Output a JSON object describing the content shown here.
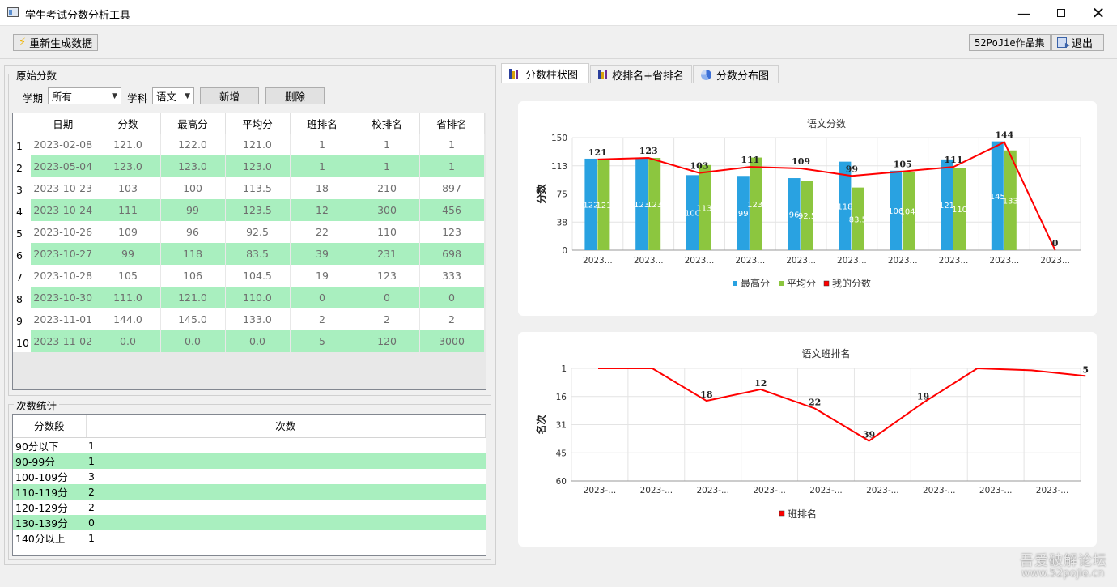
{
  "window": {
    "title": "学生考试分数分析工具"
  },
  "toolbar": {
    "regen": "重新生成数据",
    "works": "52PoJie作品集",
    "exit": "退出"
  },
  "left": {
    "raw_group": "原始分数",
    "term_label": "学期",
    "term_value": "所有",
    "subject_label": "学科",
    "subject_value": "语文",
    "add": "新增",
    "del": "删除",
    "columns": [
      "日期",
      "分数",
      "最高分",
      "平均分",
      "班排名",
      "校排名",
      "省排名"
    ],
    "rows": [
      [
        "2023-02-08",
        "121.0",
        "122.0",
        "121.0",
        "1",
        "1",
        "1"
      ],
      [
        "2023-05-04",
        "123.0",
        "123.0",
        "123.0",
        "1",
        "1",
        "1"
      ],
      [
        "2023-10-23",
        "103",
        "100",
        "113.5",
        "18",
        "210",
        "897"
      ],
      [
        "2023-10-24",
        "111",
        "99",
        "123.5",
        "12",
        "300",
        "456"
      ],
      [
        "2023-10-26",
        "109",
        "96",
        "92.5",
        "22",
        "110",
        "123"
      ],
      [
        "2023-10-27",
        "99",
        "118",
        "83.5",
        "39",
        "231",
        "698"
      ],
      [
        "2023-10-28",
        "105",
        "106",
        "104.5",
        "19",
        "123",
        "333"
      ],
      [
        "2023-10-30",
        "111.0",
        "121.0",
        "110.0",
        "0",
        "0",
        "0"
      ],
      [
        "2023-11-01",
        "144.0",
        "145.0",
        "133.0",
        "2",
        "2",
        "2"
      ],
      [
        "2023-11-02",
        "0.0",
        "0.0",
        "0.0",
        "5",
        "120",
        "3000"
      ]
    ],
    "row_numbers": [
      "1",
      "2",
      "3",
      "4",
      "5",
      "6",
      "7",
      "8",
      "9",
      "10"
    ],
    "count_group": "次数统计",
    "count_columns": [
      "分数段",
      "次数"
    ],
    "count_rows": [
      [
        "90分以下",
        "1"
      ],
      [
        "90-99分",
        "1"
      ],
      [
        "100-109分",
        "3"
      ],
      [
        "110-119分",
        "2"
      ],
      [
        "120-129分",
        "2"
      ],
      [
        "130-139分",
        "0"
      ],
      [
        "140分以上",
        "1"
      ]
    ]
  },
  "tabs": [
    "分数柱状图",
    "校排名+省排名",
    "分数分布图"
  ],
  "watermark": {
    "line1": "吾爱破解论坛",
    "line2": "www.52pojie.cn"
  },
  "colors": {
    "max": "#29a2e1",
    "avg": "#8cc63f",
    "mine": "#ff0000",
    "alt_row": "#a9efbf"
  },
  "chart_data": [
    {
      "type": "bar",
      "title": "语文分数",
      "ylabel": "分数",
      "ylim": [
        0,
        150
      ],
      "yticks": [
        "0",
        "38",
        "75",
        "113",
        "150"
      ],
      "categories": [
        "2023...",
        "2023...",
        "2023...",
        "2023...",
        "2023...",
        "2023...",
        "2023...",
        "2023...",
        "2023...",
        "2023..."
      ],
      "series": [
        {
          "name": "最高分",
          "values": [
            122,
            123,
            100,
            99,
            96,
            118,
            106,
            121,
            145,
            0
          ],
          "labels": [
            "122",
            "123",
            "100",
            "99",
            "96",
            "118",
            "106",
            "121",
            "145",
            ""
          ]
        },
        {
          "name": "平均分",
          "values": [
            121,
            123,
            113.5,
            123.5,
            92.5,
            83.5,
            104.5,
            110,
            133,
            0
          ],
          "labels": [
            "121",
            "123",
            "113.",
            "123.",
            "92.5",
            "83.5",
            "104.",
            "110",
            "133",
            ""
          ]
        },
        {
          "name": "我的分数",
          "type": "line",
          "values": [
            121,
            123,
            103,
            111,
            109,
            99,
            105,
            111,
            144,
            0
          ],
          "labels": [
            "121",
            "123",
            "103",
            "111",
            "109",
            "99",
            "105",
            "111",
            "144",
            "0"
          ]
        }
      ],
      "legend": "bottom"
    },
    {
      "type": "line",
      "title": "语文班排名",
      "ylabel": "名次",
      "ylim": [
        1,
        60
      ],
      "inverted": true,
      "yticks": [
        "1",
        "16",
        "31",
        "45",
        "60"
      ],
      "categories": [
        "2023-...",
        "2023-...",
        "2023-...",
        "2023-...",
        "2023-...",
        "2023-...",
        "2023-...",
        "2023-...",
        "2023-..."
      ],
      "series": [
        {
          "name": "班排名",
          "values": [
            1,
            1,
            18,
            12,
            22,
            39,
            19,
            0,
            2,
            5
          ],
          "labels": [
            "",
            "",
            "18",
            "12",
            "22",
            "39",
            "19",
            "",
            "",
            "5"
          ]
        }
      ],
      "legend": "bottom"
    }
  ]
}
